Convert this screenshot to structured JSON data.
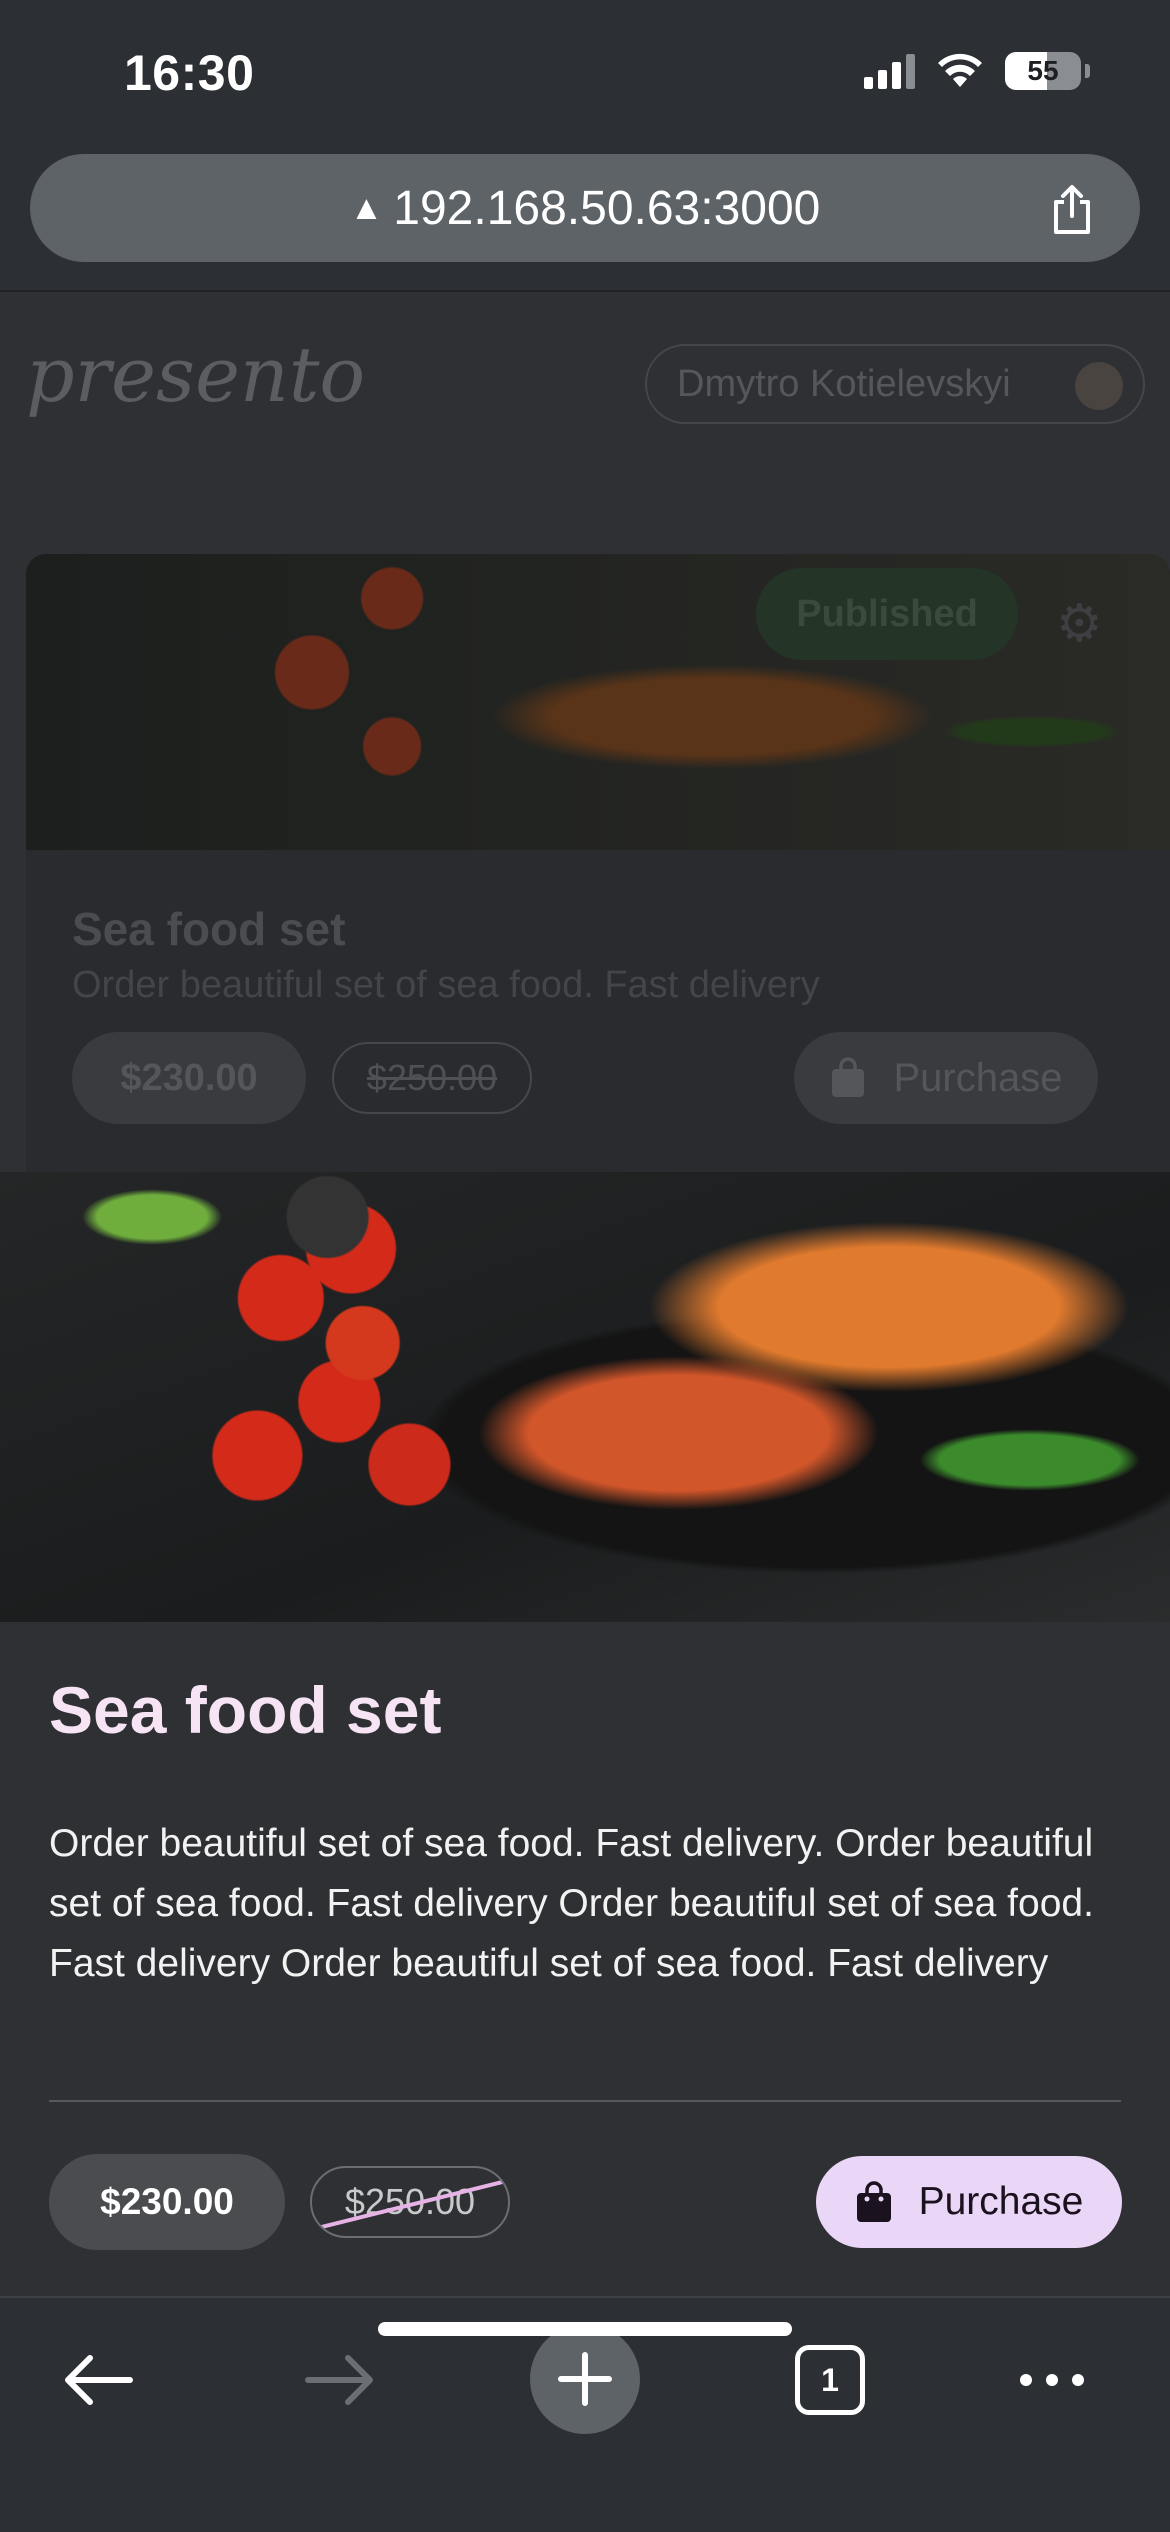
{
  "status_bar": {
    "time": "16:30",
    "battery_percent": "55",
    "icons": [
      "cellular-signal-icon",
      "wifi-icon",
      "battery-icon"
    ]
  },
  "browser": {
    "url": "192.168.50.63:3000",
    "security_icon": "warning-icon",
    "share_icon": "share-icon"
  },
  "page": {
    "logo": "presento",
    "user_name": "Dmytro Kotielevskyi",
    "card": {
      "status": "Published",
      "title": "Sea food set",
      "description": "Order beautiful set of sea food. Fast delivery",
      "price": "$230.00",
      "old_price": "$250.00",
      "purchase_label": "Purchase"
    }
  },
  "sheet": {
    "title": "Sea food set",
    "description": "Order beautiful set of sea food. Fast delivery. Order beautiful set of sea food. Fast delivery Order beautiful set of sea food. Fast delivery Order beautiful set of sea food. Fast delivery",
    "price": "$230.00",
    "old_price": "$250.00",
    "purchase_label": "Purchase"
  },
  "toolbar": {
    "tabs_count": "1",
    "items": [
      "back-arrow-icon",
      "forward-arrow-icon",
      "plus-icon",
      "tabs-icon",
      "more-icon"
    ]
  },
  "colors": {
    "accent": "#ead6f6",
    "title": "#f6e4f5",
    "sheet_bg": "#2f3033",
    "chrome_bg": "#2c2f33"
  }
}
